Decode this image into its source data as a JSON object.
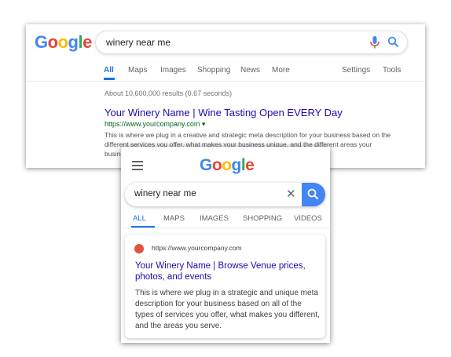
{
  "desktop": {
    "logo": [
      "G",
      "o",
      "o",
      "g",
      "l",
      "e"
    ],
    "query": "winery near me",
    "tabs": [
      "All",
      "Maps",
      "Images",
      "Shopping",
      "News",
      "More"
    ],
    "tools": [
      "Settings",
      "Tools"
    ],
    "stats": "About 10,600,000 results (0.67 seconds)",
    "result": {
      "title": "Your Winery Name | Wine Tasting Open EVERY Day",
      "url": "https://www.yourcompany.com ▾",
      "description": "This is where we plug in a creative and strategic meta description for your business based on the different services you offer, what makes your business unique, and the different areas your business serves."
    }
  },
  "mobile": {
    "logo": [
      "G",
      "o",
      "o",
      "g",
      "l",
      "e"
    ],
    "query": "winery near me",
    "clear_glyph": "✕",
    "tabs": [
      "ALL",
      "MAPS",
      "IMAGES",
      "SHOPPING",
      "VIDEOS"
    ],
    "result": {
      "url": "https://www.yourcompany.com",
      "title": "Your Winery Name | Browse Venue prices, photos, and events",
      "description": "This is where we plug in a strategic and unique meta description for your business based on all of the types of services you offer, what makes you different, and the areas you serve."
    }
  },
  "colors": {
    "link": "#1a0dab",
    "url_green": "#006621",
    "active_tab": "#1a73e8",
    "search_button": "#4285f4",
    "favicon": "#e0523c"
  }
}
